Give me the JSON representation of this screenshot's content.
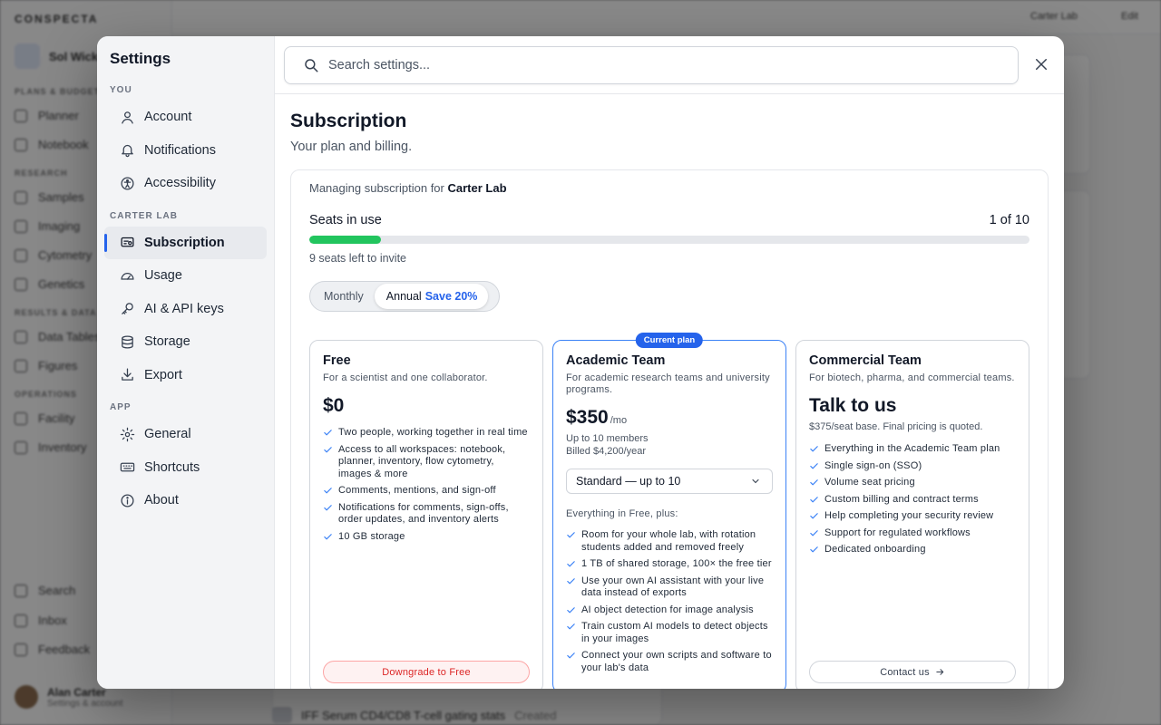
{
  "background": {
    "logo": "CONSPECTA",
    "workspace": "Sol Wick",
    "sections": [
      "PLANS & BUDGETS",
      "RESEARCH",
      "RESULTS & DATA",
      "OPERATIONS"
    ],
    "items": [
      "Planner",
      "Notebook",
      "Samples",
      "Imaging",
      "Cytometry",
      "Genetics",
      "Data Tables",
      "Figures",
      "Facility",
      "Inventory",
      "Search",
      "Inbox",
      "Feedback"
    ],
    "user_name": "Alan Carter",
    "user_sub": "Settings & account",
    "top_lab": "Carter Lab",
    "top_edit": "Edit",
    "row_text": "IFF Serum CD4/CD8 T-cell gating stats",
    "row_tag": "Created"
  },
  "sidebar": {
    "title": "Settings",
    "sections": [
      {
        "label": "YOU",
        "items": [
          {
            "label": "Account",
            "icon": "user-icon"
          },
          {
            "label": "Notifications",
            "icon": "bell-icon"
          },
          {
            "label": "Accessibility",
            "icon": "accessibility-icon"
          }
        ]
      },
      {
        "label": "CARTER LAB",
        "items": [
          {
            "label": "Subscription",
            "icon": "subscription-icon",
            "active": true
          },
          {
            "label": "Usage",
            "icon": "gauge-icon"
          },
          {
            "label": "AI & API keys",
            "icon": "key-icon"
          },
          {
            "label": "Storage",
            "icon": "database-icon"
          },
          {
            "label": "Export",
            "icon": "download-icon"
          }
        ]
      },
      {
        "label": "APP",
        "items": [
          {
            "label": "General",
            "icon": "gear-icon"
          },
          {
            "label": "Shortcuts",
            "icon": "keyboard-icon"
          },
          {
            "label": "About",
            "icon": "info-icon"
          }
        ]
      }
    ]
  },
  "search": {
    "placeholder": "Search settings..."
  },
  "page": {
    "title": "Subscription",
    "subtitle": "Your plan and billing.",
    "managing_prefix": "Managing subscription for",
    "lab_name": "Carter Lab",
    "seats_label": "Seats in use",
    "seats_value": "1 of 10",
    "seats_fraction": 0.1,
    "seats_left": "9 seats left to invite",
    "billing": {
      "monthly": "Monthly",
      "annual": "Annual",
      "save": "Save 20%",
      "selected": "annual"
    }
  },
  "plans": [
    {
      "name": "Free",
      "desc": "For a scientist and one collaborator.",
      "price": "$0",
      "features": [
        "Two people, working together in real time",
        "Access to all workspaces: notebook, planner, inventory, flow cytometry, images & more",
        "Comments, mentions, and sign-off",
        "Notifications for comments, sign-offs, order updates, and inventory alerts",
        "10 GB storage"
      ],
      "button": "Downgrade to Free"
    },
    {
      "name": "Academic Team",
      "badge": "Current plan",
      "desc": "For academic research teams and university programs.",
      "price": "$350",
      "price_unit": "/mo",
      "meta1": "Up to 10 members",
      "meta2": "Billed $4,200/year",
      "select": "Standard — up to 10",
      "plus": "Everything in Free, plus:",
      "features": [
        "Room for your whole lab, with rotation students added and removed freely",
        "1 TB of shared storage, 100× the free tier",
        "Use your own AI assistant with your live data instead of exports",
        "AI object detection for image analysis",
        "Train custom AI models to detect objects in your images",
        "Connect your own scripts and software to your lab's data"
      ]
    },
    {
      "name": "Commercial Team",
      "desc": "For biotech, pharma, and commercial teams.",
      "price": "Talk to us",
      "meta1": "$375/seat base. Final pricing is quoted.",
      "features": [
        "Everything in the Academic Team plan",
        "Single sign-on (SSO)",
        "Volume seat pricing",
        "Custom billing and contract terms",
        "Help completing your security review",
        "Support for regulated workflows",
        "Dedicated onboarding"
      ],
      "button": "Contact us"
    }
  ],
  "colors": {
    "accent": "#2563eb",
    "success": "#22c55e",
    "danger": "#dc2626"
  }
}
